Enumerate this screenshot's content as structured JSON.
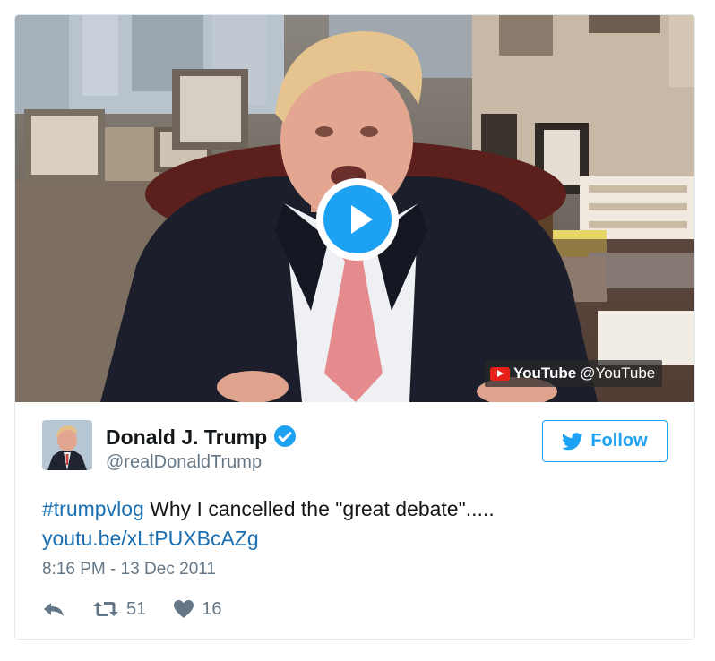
{
  "media": {
    "play_icon": "play-icon",
    "badge": {
      "logo_icon": "youtube-logo-icon",
      "brand": "YouTube",
      "handle": "@YouTube"
    }
  },
  "author": {
    "name": "Donald J. Trump",
    "handle": "@realDonaldTrump",
    "verified_icon": "verified-badge-icon"
  },
  "follow_button": {
    "icon": "twitter-bird-icon",
    "label": "Follow"
  },
  "tweet": {
    "hashtag": "#trumpvlog",
    "text": " Why I cancelled the \"great debate\".....",
    "link": "youtu.be/xLtPUXBcAZg",
    "timestamp": "8:16 PM - 13 Dec 2011"
  },
  "actions": {
    "reply_icon": "reply-icon",
    "retweet_icon": "retweet-icon",
    "retweet_count": "51",
    "like_icon": "heart-icon",
    "like_count": "16"
  },
  "colors": {
    "accent": "#1da1f2",
    "link": "#1b6fb0",
    "muted": "#657786",
    "text": "#14171a",
    "youtube_red": "#e62117"
  }
}
